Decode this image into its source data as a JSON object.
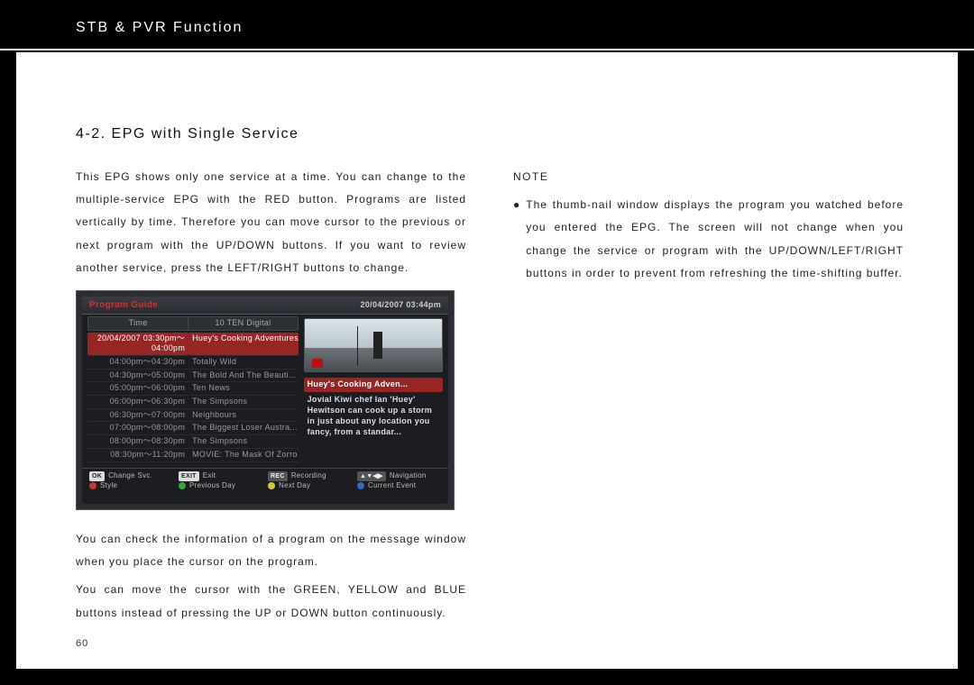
{
  "header": {
    "title": "STB & PVR Function"
  },
  "section": {
    "title": "4-2. EPG with Single Service"
  },
  "left": {
    "p1": "This EPG shows only one service at a time. You can change to the multiple-service EPG with the RED button. Programs are listed vertically by time. Therefore you can move cursor to the previous or next program with the UP/DOWN buttons. If you want to review another service, press the LEFT/RIGHT buttons to change.",
    "p2": "You can check the information of a program on the message window when you place the cursor on the program.",
    "p3": "You can move the cursor with the GREEN, YELLOW and BLUE buttons instead of pressing the UP or DOWN button continuously."
  },
  "right": {
    "note_label": "NOTE",
    "bullet": "●",
    "note1": "The thumb-nail window displays the program you watched before you entered the EPG. The screen will not change when you change the service or program with the UP/DOWN/LEFT/RIGHT buttons in order to prevent from refreshing the time-shifting buffer."
  },
  "figure": {
    "title": "Program Guide",
    "datetime": "20/04/2007   03:44pm",
    "col_time": "Time",
    "col_channel": "10   TEN Digital",
    "rows": [
      {
        "time": "20/04/2007 03:30pm～04:00pm",
        "name": "Huey's Cooking Adventures",
        "selected": true
      },
      {
        "time": "04:00pm～04:30pm",
        "name": "Totally Wild",
        "selected": false
      },
      {
        "time": "04:30pm～05:00pm",
        "name": "The Bold And The Beauti...",
        "selected": false
      },
      {
        "time": "05:00pm～06:00pm",
        "name": "Ten News",
        "selected": false
      },
      {
        "time": "06:00pm～06:30pm",
        "name": "The Simpsons",
        "selected": false
      },
      {
        "time": "06:30pm～07:00pm",
        "name": "Neighbours",
        "selected": false
      },
      {
        "time": "07:00pm～08:00pm",
        "name": "The Biggest Loser Austra...",
        "selected": false
      },
      {
        "time": "08:00pm～08:30pm",
        "name": "The Simpsons",
        "selected": false
      },
      {
        "time": "08:30pm～11:20pm",
        "name": "MOVIE: The Mask Of Zorro",
        "selected": false
      }
    ],
    "preview": {
      "title": "Huey's Cooking Adven...",
      "desc": "Jovial Kiwi chef Ian 'Huey' Hewitson can cook up a storm in just about any location you fancy, from a standar..."
    },
    "controls_row1": [
      {
        "key": "OK",
        "label": "Change Svc."
      },
      {
        "key": "EXIT",
        "label": "Exit"
      },
      {
        "key": "REC",
        "label": "Recording"
      },
      {
        "key": "▲▼◀▶",
        "label": "Navigation"
      }
    ],
    "controls_row2": [
      {
        "color": "red",
        "label": "Style"
      },
      {
        "color": "green",
        "label": "Previous Day"
      },
      {
        "color": "yellow",
        "label": "Next Day"
      },
      {
        "color": "blue",
        "label": "Current Event"
      }
    ]
  },
  "page_number": "60"
}
